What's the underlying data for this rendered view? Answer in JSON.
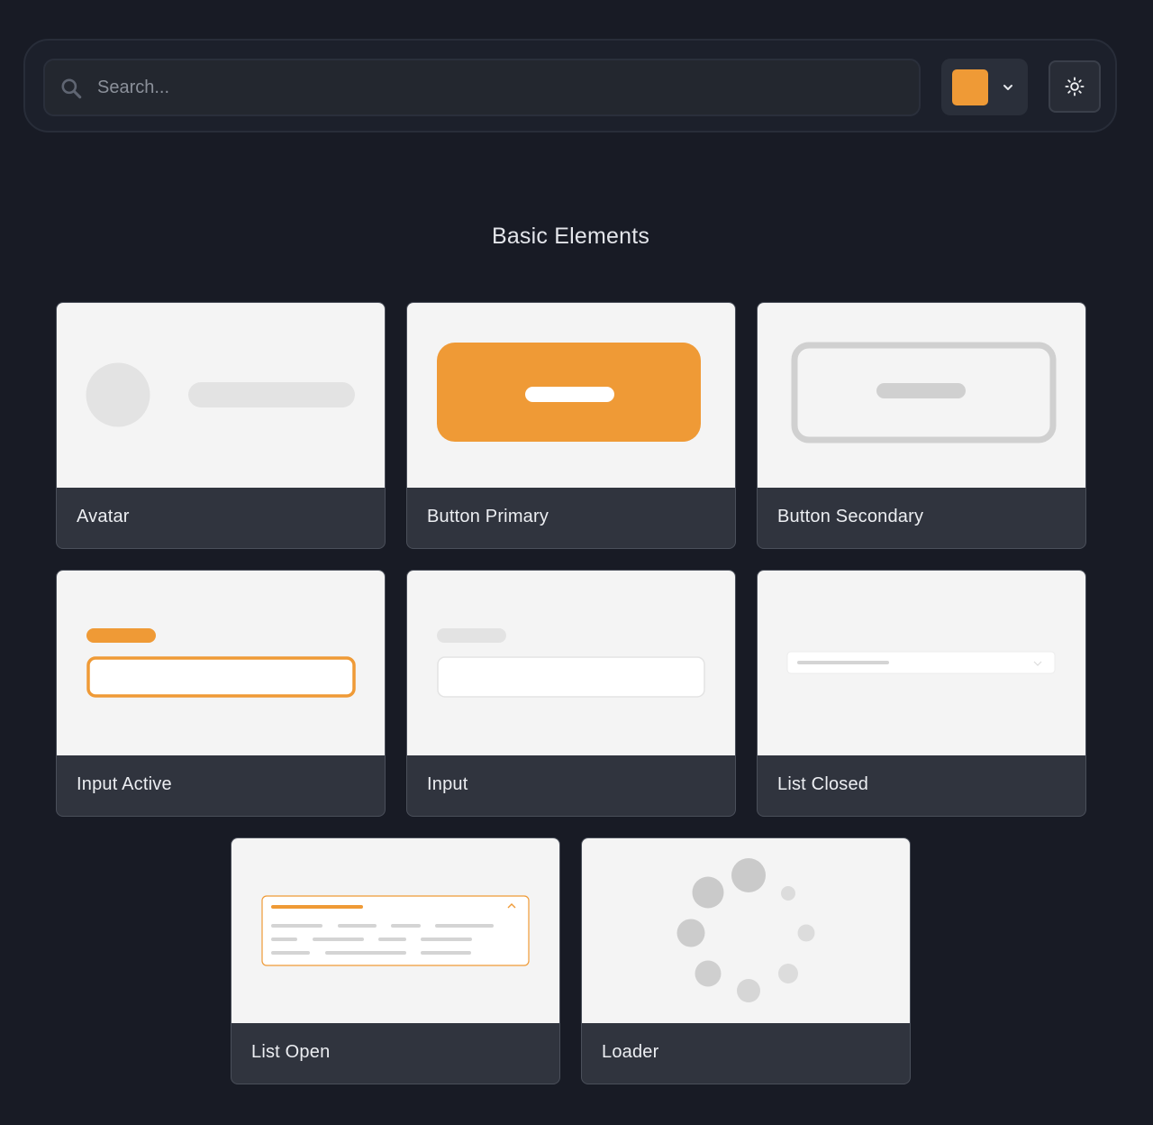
{
  "search": {
    "placeholder": "Search..."
  },
  "color_picker": {
    "selected_color": "#ef9a36"
  },
  "theme_toggle": {
    "icon": "sun-icon"
  },
  "section": {
    "title": "Basic Elements"
  },
  "cards": [
    {
      "label": "Avatar"
    },
    {
      "label": "Button Primary"
    },
    {
      "label": "Button Secondary"
    },
    {
      "label": "Input Active"
    },
    {
      "label": "Input"
    },
    {
      "label": "List Closed"
    },
    {
      "label": "List Open"
    },
    {
      "label": "Loader"
    }
  ],
  "colors": {
    "accent": "#ef9a36",
    "background": "#181b25",
    "card_footer": "#30343e",
    "preview_bg": "#f4f4f4",
    "skeleton": "#e3e3e3"
  }
}
